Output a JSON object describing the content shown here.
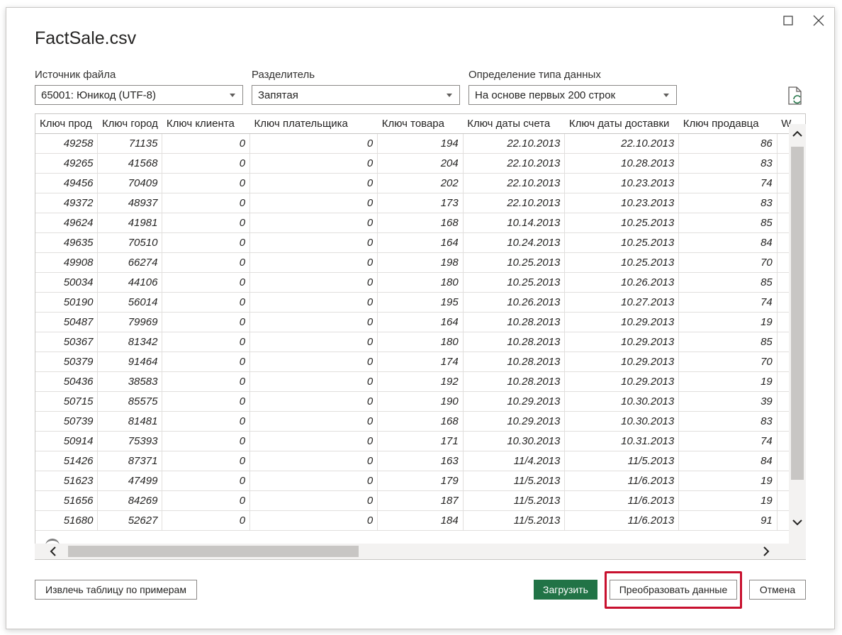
{
  "title": "FactSale.csv",
  "colors": {
    "accent_load": "#217346",
    "highlight": "#c8102e"
  },
  "file_origin": {
    "label": "Источник файла",
    "value": "65001: Юникод (UTF-8)"
  },
  "delimiter": {
    "label": "Разделитель",
    "value": "Запятая"
  },
  "type_detection": {
    "label": "Определение типа данных",
    "value": "На основе первых 200 строк"
  },
  "icons": [
    "maximize-icon",
    "close-icon",
    "refresh-icon",
    "chevron-up-icon",
    "chevron-down-icon",
    "chevron-left-icon",
    "chevron-right-icon"
  ],
  "table": {
    "headers": [
      "Ключ прод",
      "Ключ город",
      "Ключ клиента",
      "Ключ плательщика",
      "Ключ товара",
      "Ключ даты счета",
      "Ключ даты доставки",
      "Ключ продавца",
      "W"
    ],
    "rows": [
      [
        "49258",
        "71135",
        "0",
        "0",
        "194",
        "22.10.2013",
        "22.10.2013",
        "86"
      ],
      [
        "49265",
        "41568",
        "0",
        "0",
        "204",
        "22.10.2013",
        "10.28.2013",
        "83"
      ],
      [
        "49456",
        "70409",
        "0",
        "0",
        "202",
        "22.10.2013",
        "10.23.2013",
        "74"
      ],
      [
        "49372",
        "48937",
        "0",
        "0",
        "173",
        "22.10.2013",
        "10.23.2013",
        "83"
      ],
      [
        "49624",
        "41981",
        "0",
        "0",
        "168",
        "10.14.2013",
        "10.25.2013",
        "85"
      ],
      [
        "49635",
        "70510",
        "0",
        "0",
        "164",
        "10.24.2013",
        "10.25.2013",
        "84"
      ],
      [
        "49908",
        "66274",
        "0",
        "0",
        "198",
        "10.25.2013",
        "10.25.2013",
        "70"
      ],
      [
        "50034",
        "44106",
        "0",
        "0",
        "180",
        "10.25.2013",
        "10.26.2013",
        "85"
      ],
      [
        "50190",
        "56014",
        "0",
        "0",
        "195",
        "10.26.2013",
        "10.27.2013",
        "74"
      ],
      [
        "50487",
        "79969",
        "0",
        "0",
        "164",
        "10.28.2013",
        "10.29.2013",
        "19"
      ],
      [
        "50367",
        "81342",
        "0",
        "0",
        "180",
        "10.28.2013",
        "10.29.2013",
        "85"
      ],
      [
        "50379",
        "91464",
        "0",
        "0",
        "174",
        "10.28.2013",
        "10.29.2013",
        "70"
      ],
      [
        "50436",
        "38583",
        "0",
        "0",
        "192",
        "10.28.2013",
        "10.29.2013",
        "19"
      ],
      [
        "50715",
        "85575",
        "0",
        "0",
        "190",
        "10.29.2013",
        "10.30.2013",
        "39"
      ],
      [
        "50739",
        "81481",
        "0",
        "0",
        "168",
        "10.29.2013",
        "10.30.2013",
        "83"
      ],
      [
        "50914",
        "75393",
        "0",
        "0",
        "171",
        "10.30.2013",
        "10.31.2013",
        "74"
      ],
      [
        "51426",
        "87371",
        "0",
        "0",
        "163",
        "11/4.2013",
        "11/5.2013",
        "84"
      ],
      [
        "51623",
        "47499",
        "0",
        "0",
        "179",
        "11/5.2013",
        "11/6.2013",
        "19"
      ],
      [
        "51656",
        "84269",
        "0",
        "0",
        "187",
        "11/5.2013",
        "11/6.2013",
        "19"
      ],
      [
        "51680",
        "52627",
        "0",
        "0",
        "184",
        "11/5.2013",
        "11/6.2013",
        "91"
      ]
    ]
  },
  "buttons": {
    "extract": "Извлечь таблицу по примерам",
    "load": "Загрузить",
    "transform": "Преобразовать данные",
    "cancel": "Отмена"
  }
}
